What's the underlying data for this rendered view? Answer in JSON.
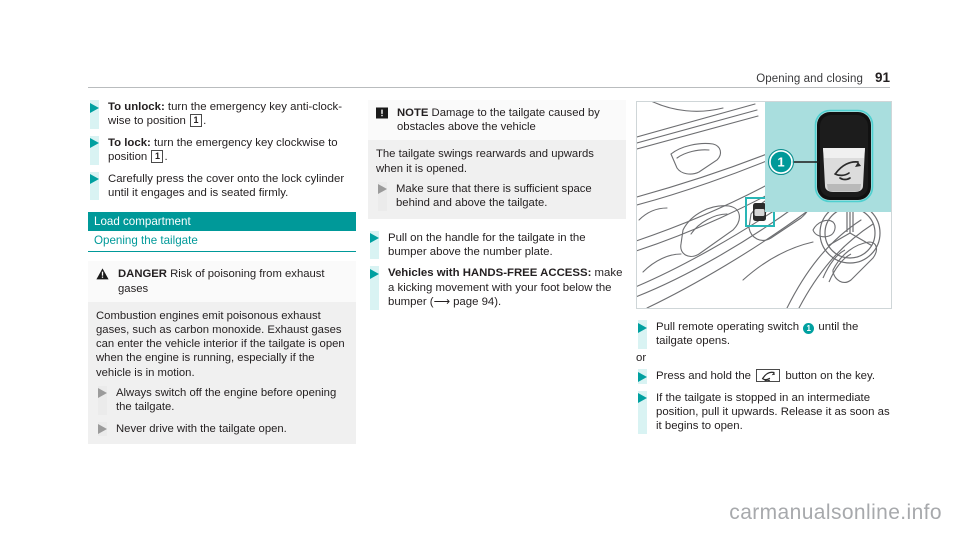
{
  "header": {
    "title": "Opening and closing",
    "page_number": "91"
  },
  "column1": {
    "bullets": [
      {
        "lead": "To unlock:",
        "text": " turn the emergency key anti-clock-wise to position ",
        "numbox": "1",
        "tail": "."
      },
      {
        "lead": "To lock:",
        "text": " turn the emergency key clockwise to position ",
        "numbox": "1",
        "tail": "."
      },
      {
        "lead": "",
        "text": "Carefully press the cover onto the lock cylinder until it engages and is seated firmly.",
        "numbox": "",
        "tail": ""
      }
    ],
    "section_band": "Load compartment",
    "sub_heading": "Opening the tailgate",
    "danger": {
      "icon": "warning-triangle-icon",
      "keyword": "DANGER",
      "headline": " Risk of poisoning from exhaust gases",
      "body": "Combustion engines emit poisonous exhaust gases, such as carbon monoxide. Exhaust gases can enter the vehicle interior if the tailgate is open when the engine is running, especially if the vehicle is in motion.",
      "bullets": [
        "Always switch off the engine before opening the tailgate.",
        "Never drive with the tailgate open."
      ]
    }
  },
  "column2": {
    "note": {
      "icon": "note-exclamation-icon",
      "keyword": "NOTE",
      "headline": " Damage to the tailgate caused by obstacles above the vehicle",
      "body": "The tailgate swings rearwards and upwards when it is opened.",
      "bullets": [
        "Make sure that there is sufficient space behind and above the tailgate."
      ]
    },
    "bullets": [
      {
        "lead": "",
        "text": "Pull on the handle for the tailgate in the bumper above the number plate."
      },
      {
        "lead": "Vehicles with HANDS-FREE ACCESS:",
        "text": " make a kicking movement with your foot below the bumper (⟶ page 94)."
      }
    ]
  },
  "column3": {
    "figure": {
      "name": "door-panel-illustration",
      "callout_number": "1",
      "inset_label": "tailgate-switch-inset"
    },
    "bullets_top": [
      {
        "pre": "Pull remote operating switch ",
        "circnum": "1",
        "post": " until the tailgate opens."
      }
    ],
    "or_text": "or",
    "bullets_bottom": [
      {
        "pre": "Press and hold the ",
        "keyglyph": "tailgate-open-key-icon",
        "post": " button on the key."
      },
      {
        "pre": "If the tailgate is stopped in an intermediate position, pull it upwards. Release it as soon as it begins to open.",
        "keyglyph": "",
        "post": ""
      }
    ]
  },
  "watermark": "carmanualsonline.info",
  "colors": {
    "teal": "#009999",
    "teal_bullet": "#00a0a0",
    "bullet_bar": "#d9f3f3",
    "warn_head_bg": "#fafafa",
    "warn_body_bg": "#f0f0f0",
    "inset_bg": "#a9dede"
  }
}
